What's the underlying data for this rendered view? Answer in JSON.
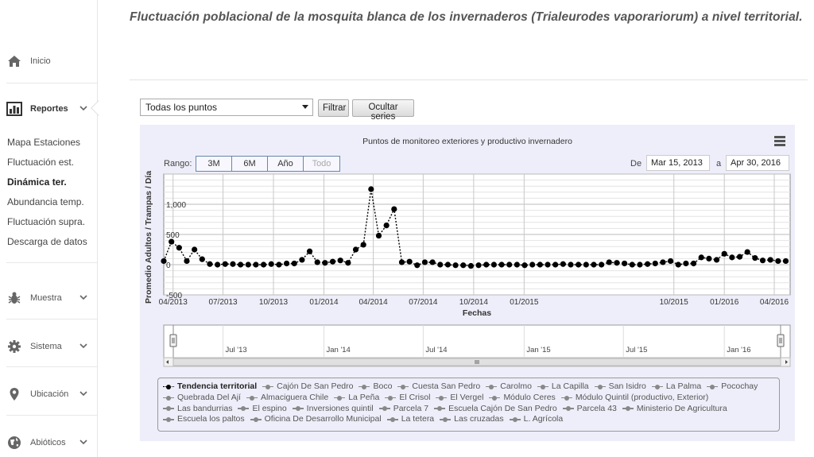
{
  "header": {
    "title": "Fluctuación poblacional de la mosquita blanca de los invernaderos (Trialeurodes vaporariorum) a nivel territorial."
  },
  "sidebar": {
    "main_items": [
      {
        "label": "Inicio",
        "icon": "home-icon"
      },
      {
        "label": "Reportes",
        "icon": "bar-chart-icon"
      },
      {
        "label": "Muestra",
        "icon": "bug-icon"
      },
      {
        "label": "Sistema",
        "icon": "gear-icon"
      },
      {
        "label": "Ubicación",
        "icon": "map-marker-icon"
      },
      {
        "label": "Abióticos",
        "icon": "globe-icon"
      }
    ],
    "sub_items": [
      {
        "label": "Mapa Estaciones"
      },
      {
        "label": "Fluctuación est."
      },
      {
        "label": "Dinámica ter."
      },
      {
        "label": "Abundancia temp."
      },
      {
        "label": "Fluctuación supra."
      },
      {
        "label": "Descarga de datos"
      }
    ]
  },
  "filter": {
    "select_value": "Todas los puntos",
    "filter_label": "Filtrar",
    "hide_series_label": "Ocultar series"
  },
  "chart": {
    "title": "Puntos de monitoreo exteriores y productivo invernadero",
    "range_label": "Rango:",
    "range_buttons": [
      "3M",
      "6M",
      "Año",
      "Todo"
    ],
    "from_label": "De",
    "from_date": "Mar 15, 2013",
    "to_label": "a",
    "to_date": "Apr 30, 2016",
    "navigator_labels": [
      "Jul '13",
      "Jan '14",
      "Jul '14",
      "Jan '15",
      "Jul '15",
      "Jan '16"
    ]
  },
  "chart_data": {
    "type": "line",
    "title": "Puntos de monitoreo exteriores y productivo invernadero",
    "xlabel": "Fechas",
    "ylabel": "Promedio Adultos / Trampas / Día",
    "ylim": [
      -500,
      1500
    ],
    "y_ticks": [
      "-500",
      "0",
      "500",
      "1,000"
    ],
    "x_ticks": [
      "04/2013",
      "07/2013",
      "10/2013",
      "01/2014",
      "04/2014",
      "07/2014",
      "10/2014",
      "01/2015",
      "10/2015",
      "01/2016",
      "04/2016"
    ],
    "x_range": [
      "2013-03-15",
      "2016-04-30"
    ],
    "grid": true,
    "series": [
      {
        "name": "Tendencia territorial",
        "x": [
          "2013-03-15",
          "2013-03-29",
          "2013-04-12",
          "2013-04-26",
          "2013-05-10",
          "2013-05-24",
          "2013-06-07",
          "2013-06-21",
          "2013-07-05",
          "2013-07-19",
          "2013-08-02",
          "2013-08-16",
          "2013-08-30",
          "2013-09-13",
          "2013-09-27",
          "2013-10-11",
          "2013-10-25",
          "2013-11-08",
          "2013-11-22",
          "2013-12-06",
          "2013-12-20",
          "2014-01-03",
          "2014-01-17",
          "2014-01-31",
          "2014-02-14",
          "2014-02-28",
          "2014-03-14",
          "2014-03-28",
          "2014-04-11",
          "2014-04-25",
          "2014-05-09",
          "2014-05-23",
          "2014-06-06",
          "2014-06-20",
          "2014-07-04",
          "2014-07-18",
          "2014-08-01",
          "2014-08-15",
          "2014-08-29",
          "2014-09-12",
          "2014-09-26",
          "2014-10-10",
          "2014-10-24",
          "2014-11-07",
          "2014-11-21",
          "2014-12-05",
          "2014-12-19",
          "2015-01-02",
          "2015-01-16",
          "2015-01-30",
          "2015-02-13",
          "2015-02-27",
          "2015-03-13",
          "2015-03-27",
          "2015-04-10",
          "2015-04-24",
          "2015-05-08",
          "2015-05-22",
          "2015-06-05",
          "2015-06-19",
          "2015-07-03",
          "2015-07-17",
          "2015-07-31",
          "2015-08-14",
          "2015-08-28",
          "2015-09-11",
          "2015-09-25",
          "2015-10-09",
          "2015-10-23",
          "2015-11-06",
          "2015-11-20",
          "2015-12-04",
          "2015-12-18",
          "2016-01-01",
          "2016-01-15",
          "2016-01-29",
          "2016-02-12",
          "2016-02-26",
          "2016-03-11",
          "2016-03-25",
          "2016-04-08",
          "2016-04-22"
        ],
        "y": [
          60,
          380,
          280,
          60,
          250,
          90,
          10,
          0,
          10,
          10,
          0,
          0,
          0,
          0,
          10,
          0,
          20,
          20,
          80,
          220,
          40,
          30,
          50,
          70,
          30,
          250,
          330,
          1250,
          480,
          650,
          920,
          40,
          50,
          -10,
          40,
          40,
          0,
          0,
          -10,
          -10,
          -20,
          -10,
          0,
          0,
          0,
          0,
          0,
          -10,
          0,
          0,
          0,
          0,
          10,
          0,
          0,
          0,
          0,
          0,
          40,
          30,
          20,
          0,
          0,
          10,
          20,
          40,
          60,
          0,
          20,
          20,
          120,
          100,
          80,
          180,
          120,
          130,
          210,
          110,
          70,
          80,
          60,
          60
        ]
      }
    ],
    "legend": [
      "Tendencia territorial",
      "Cajón De San Pedro",
      "Boco",
      "Cuesta San Pedro",
      "Carolmo",
      "La Capilla",
      "San Isidro",
      "La Palma",
      "Pocochay",
      "Quebrada Del Ají",
      "Almaciguera Chile",
      "La Peña",
      "El Crisol",
      "El Vergel",
      "Módulo Ceres",
      "Módulo Quintil (productivo, Exterior)",
      "Las bandurrias",
      "El espino",
      "Inversiones quintil",
      "Parcela 7",
      "Escuela Cajón De San Pedro",
      "Parcela 43",
      "Ministerio De Agricultura",
      "Escuela los paltos",
      "Oficina De Desarrollo Municipal",
      "La tetera",
      "Las cruzadas",
      "L. Agrícola"
    ],
    "legend_placement": "bottom"
  }
}
